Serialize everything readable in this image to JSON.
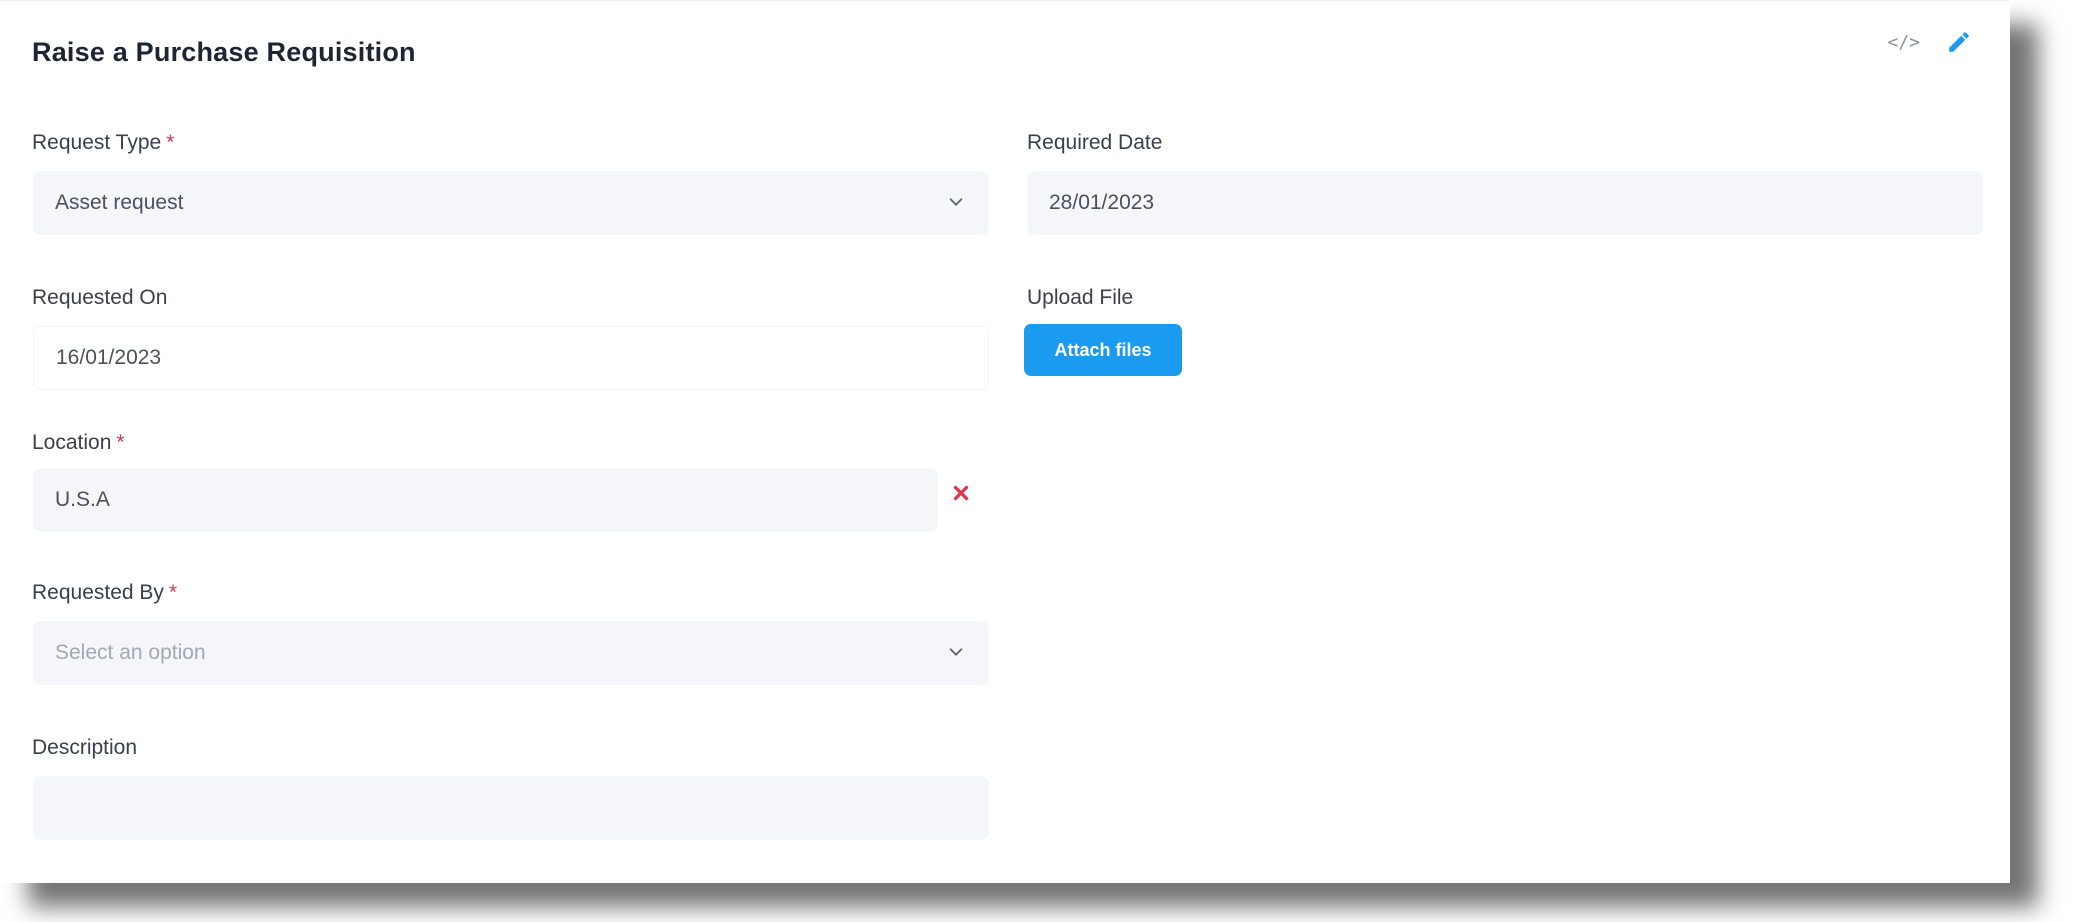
{
  "form": {
    "title": "Raise a Purchase Requisition",
    "header_icons": {
      "code": "</>",
      "code_icon_name": "code-icon",
      "edit_icon_name": "pencil-icon"
    },
    "request_type": {
      "label": "Request Type",
      "required_mark": "*",
      "value": "Asset request"
    },
    "required_date": {
      "label": "Required Date",
      "value": "28/01/2023"
    },
    "requested_on": {
      "label": "Requested On",
      "value": "16/01/2023"
    },
    "upload_file": {
      "label": "Upload File",
      "button_label": "Attach files"
    },
    "location": {
      "label": "Location",
      "required_mark": "*",
      "value": "U.S.A"
    },
    "requested_by": {
      "label": "Requested By",
      "required_mark": "*",
      "placeholder": "Select an option"
    },
    "description": {
      "label": "Description",
      "value": ""
    }
  },
  "colors": {
    "accent": "#1a9bf0",
    "required": "#e0334d",
    "field_bg": "#f4f6f9",
    "title_text": "#1f2433"
  }
}
